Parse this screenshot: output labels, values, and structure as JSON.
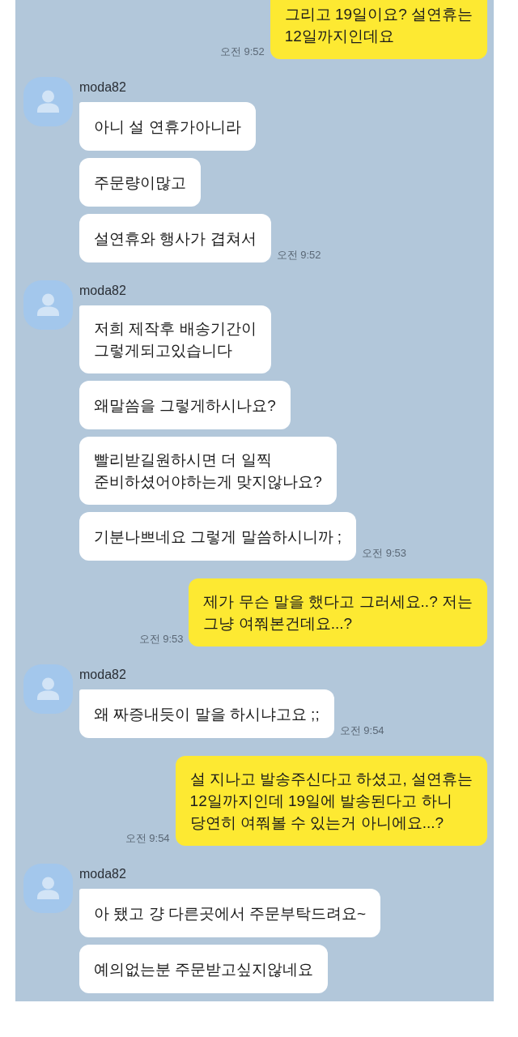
{
  "chat": {
    "items": [
      {
        "kind": "sent",
        "text": "그리고 19일이요? 설연휴는\n12일까지인데요",
        "time": "오전 9:52"
      },
      {
        "kind": "received",
        "sender": "moda82",
        "messages": [
          "아니 설 연휴가아니라",
          "주문량이많고",
          "설연휴와 행사가 겹쳐서"
        ],
        "time": "오전 9:52"
      },
      {
        "kind": "received",
        "sender": "moda82",
        "messages": [
          "저희 제작후 배송기간이\n그렇게되고있습니다",
          "왜말씀을 그렇게하시나요?",
          "빨리받길원하시면 더 일찍\n준비하셨어야하는게 맞지않나요?",
          "기분나쁘네요 그렇게 말씀하시니까 ;"
        ],
        "time": "오전 9:53"
      },
      {
        "kind": "sent",
        "text": "제가 무슨 말을 했다고 그러세요..? 저는\n그냥 여쭤본건데요...?",
        "time": "오전 9:53"
      },
      {
        "kind": "received",
        "sender": "moda82",
        "messages": [
          "왜 짜증내듯이 말을 하시냐고요 ;;"
        ],
        "time": "오전 9:54"
      },
      {
        "kind": "sent",
        "text": "설 지나고 발송주신다고 하셨고, 설연휴는\n12일까지인데 19일에 발송된다고 하니\n당연히 여쭤볼 수 있는거 아니에요...?",
        "time": "오전 9:54"
      },
      {
        "kind": "received",
        "sender": "moda82",
        "messages": [
          "아 됐고 걍 다른곳에서 주문부탁드려요~",
          "예의없는분 주문받고싶지않네요"
        ]
      }
    ]
  }
}
